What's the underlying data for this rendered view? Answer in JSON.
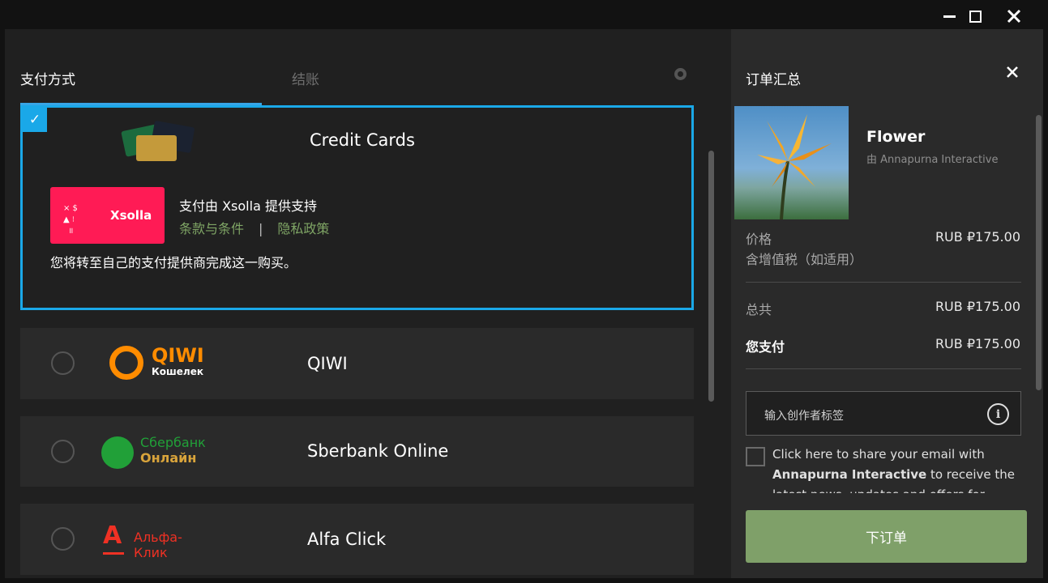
{
  "window": {
    "minimize_icon": "minimize-icon",
    "maximize_icon": "maximize-icon",
    "close_icon": "close-icon"
  },
  "tabs": {
    "payment": "支付方式",
    "checkout": "结账"
  },
  "payment_methods": {
    "credit_cards": {
      "name": "Credit Cards",
      "selected": true,
      "provider_logo": "Xsolla",
      "provider_line": "支付由 Xsolla 提供支持",
      "terms_link": "条款与条件",
      "separator": "|",
      "privacy_link": "隐私政策",
      "redirect_text": "您将转至自己的支付提供商完成这一购买。"
    },
    "qiwi": {
      "name": "QIWI",
      "logo_word": "QIWI",
      "logo_sub": "Кошелек"
    },
    "sberbank": {
      "name": "Sberbank Online",
      "logo_line1": "Сбербанк",
      "logo_line2": "Онлайн"
    },
    "alfa": {
      "name": "Alfa Click",
      "logo_letter": "А",
      "logo_word": "Альфа-Клик"
    }
  },
  "summary": {
    "title": "订单汇总",
    "product_name": "Flower",
    "publisher": "由 Annapurna Interactive",
    "price_label": "价格",
    "vat_label": "含增值税（如适用）",
    "price_value": "RUB ₽175.00",
    "total_label": "总共",
    "total_value": "RUB ₽175.00",
    "you_pay_label": "您支付",
    "you_pay_value": "RUB ₽175.00",
    "creator_tag_placeholder": "输入创作者标签",
    "share_text_1": "Click here to share your email with ",
    "share_text_bold": "Annapurna Interactive",
    "share_text_2": " to receive the latest news, updates and offers for their",
    "place_order": "下订单"
  },
  "colors": {
    "accent_blue": "#1aa8e8",
    "order_green": "#7fa069",
    "link_green": "#7fa565",
    "xsolla_pink": "#ff1b55"
  }
}
